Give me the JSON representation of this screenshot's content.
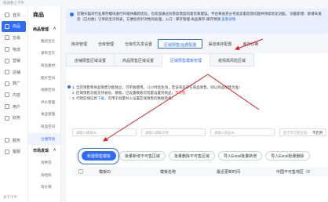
{
  "topbar": {
    "text": "链速数上千牛"
  },
  "nav_primary": {
    "items": [
      {
        "label": "首页",
        "icon": "home-icon"
      },
      {
        "label": "商品",
        "icon": "goods-icon"
      },
      {
        "label": "交易",
        "icon": "trade-icon"
      },
      {
        "label": "物流",
        "icon": "logistics-icon"
      },
      {
        "label": "营销",
        "icon": "marketing-icon"
      },
      {
        "label": "店铺",
        "icon": "shop-icon"
      },
      {
        "label": "数广",
        "icon": "data-icon"
      },
      {
        "label": "内容",
        "icon": "content-icon"
      },
      {
        "label": "用户",
        "icon": "user-icon"
      },
      {
        "label": "财务",
        "icon": "finance-icon"
      },
      {
        "label": "",
        "icon": ""
      },
      {
        "label": "服务",
        "icon": "service-icon"
      },
      {
        "label": "客服",
        "icon": "cs-icon"
      }
    ],
    "footer": "关于千牛"
  },
  "nav_secondary": {
    "title": "商品",
    "groups": [
      {
        "label": "商品管理",
        "items": [
          "我的宝贝",
          "发布宝贝",
          "商品素材",
          "图片空间",
          "视频空间",
          "评价管理",
          "食品管理",
          "商品空间",
          "仓储市场"
        ]
      },
      {
        "label": "市场发现",
        "items": [
          "淘供货",
          "淘经机",
          "淘分销"
        ]
      }
    ],
    "active_item": "仓储市场"
  },
  "notice": {
    "text": "近期天猫对行业库存模块进行升级并最新优化，也欢迎通过问卷反馈您的意见和建议。平台将会充分考虑卖家反馈问题并持续优化功能。",
    "line2_prefix": "功能新增：新增未发货（已付款）订单的宝贝列表，方便您有针对性的处理。入口：库存管理-商品库存-库存预测",
    "link": "查看详情"
  },
  "tabs_top": [
    "库存管理",
    "仓库管理",
    "仓库优先发设置",
    "区域限售/运费配置",
    "渠道库存配置",
    "库存诊断"
  ],
  "active_top_tab": 3,
  "tabs_sub": [
    "店铺限售区域设置",
    "商品限售区域设置",
    "区域限售模板管理",
    "疫情高风险区域"
  ],
  "active_sub_tab": 2,
  "tips": {
    "line1": "1. 全店限售和商品限售功能独立，可单独使用。（1小时后生效，若该商品存在商品限售，则以商品限售为准）",
    "line2": "2. 区域限售功能支持省份、模板，已设置模板可批量设置到商品；",
    "line2_red": "不可售",
    "line3_prefix": "3. 行政区域信息",
    "line3_blue": "下载",
    "line3_suffix": "，可用于批量导入设置区域限售的数据参考。"
  },
  "filters": {
    "template_id_placeholder": "请输入模板ID",
    "template_name_placeholder": "请输入模板名称",
    "product_id_placeholder": "请输入商品ID",
    "select_label": "是否不可售区域",
    "select_value": "不启用"
  },
  "actions": {
    "create": "新建限售模板",
    "batch_add": "批量新增不可售区域",
    "batch_delete": "批量删除不可售区域",
    "import_add": "导入Excel批量新增",
    "import_delete": "导入Excel批量删除"
  },
  "table": {
    "columns": [
      "模板ID",
      "模板名称",
      "最近更新时间",
      "中国不可售地区（0"
    ]
  }
}
